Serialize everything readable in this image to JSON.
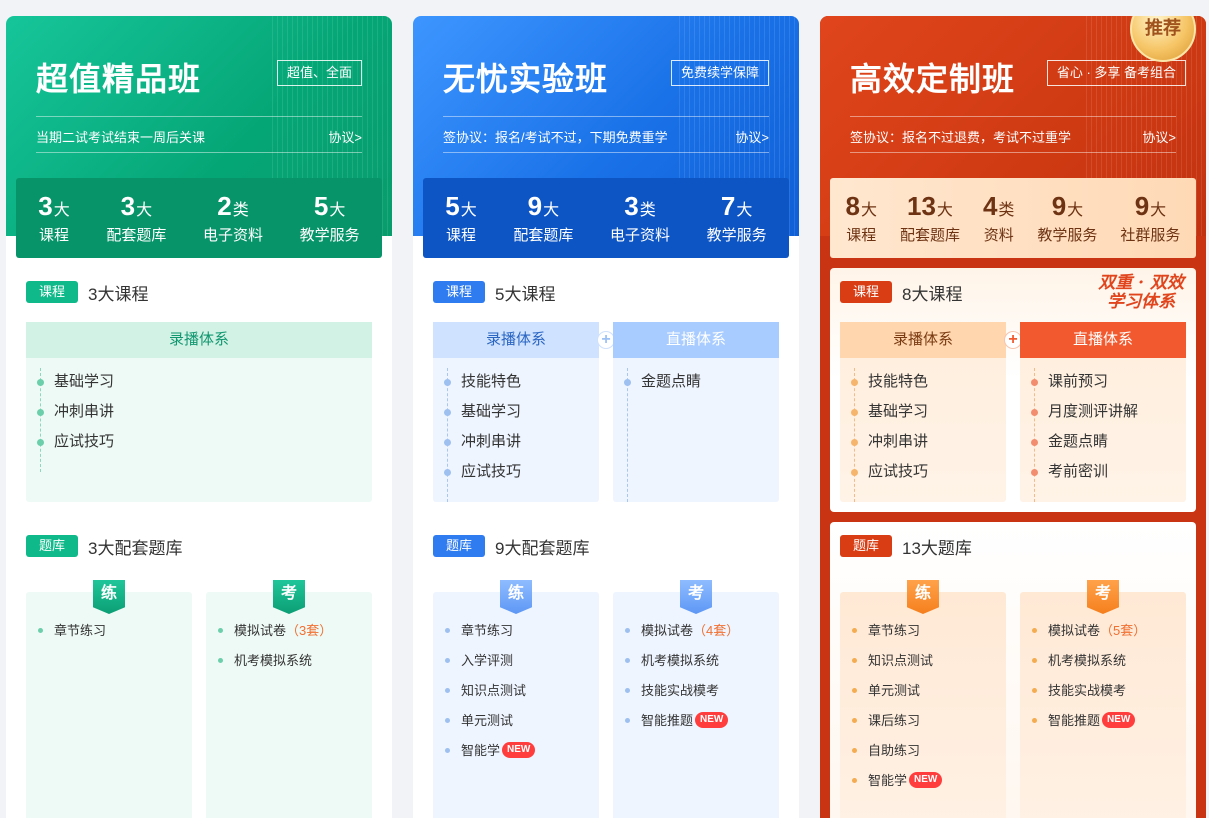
{
  "cards": [
    {
      "title": "超值精品班",
      "tag": "超值、全面",
      "agreement": "当期二试考试结束一周后关课",
      "agreement_link": "协议>",
      "stats": [
        {
          "num": "3",
          "unit": "大",
          "label": "课程"
        },
        {
          "num": "3",
          "unit": "大",
          "label": "配套题库"
        },
        {
          "num": "2",
          "unit": "类",
          "label": "电子资料"
        },
        {
          "num": "5",
          "unit": "大",
          "label": "教学服务"
        }
      ],
      "course": {
        "badge": "课程",
        "title": "3大课程",
        "systems": [
          {
            "name": "录播体系",
            "items": [
              "基础学习",
              "冲刺串讲",
              "应试技巧"
            ]
          }
        ]
      },
      "bank": {
        "badge": "题库",
        "title": "3大配套题库",
        "practice": {
          "label": "练",
          "items": [
            {
              "text": "章节练习"
            }
          ]
        },
        "exam": {
          "label": "考",
          "items": [
            {
              "text": "模拟试卷",
              "extra": "（3套）"
            },
            {
              "text": "机考模拟系统"
            }
          ]
        }
      }
    },
    {
      "title": "无忧实验班",
      "tag": "免费续学保障",
      "agreement": "签协议：报名/考试不过，下期免费重学",
      "agreement_link": "协议>",
      "stats": [
        {
          "num": "5",
          "unit": "大",
          "label": "课程"
        },
        {
          "num": "9",
          "unit": "大",
          "label": "配套题库"
        },
        {
          "num": "3",
          "unit": "类",
          "label": "电子资料"
        },
        {
          "num": "7",
          "unit": "大",
          "label": "教学服务"
        }
      ],
      "course": {
        "badge": "课程",
        "title": "5大课程",
        "systems": [
          {
            "name": "录播体系",
            "items": [
              "技能特色",
              "基础学习",
              "冲刺串讲",
              "应试技巧"
            ]
          },
          {
            "name": "直播体系",
            "items": [
              "金题点睛"
            ]
          }
        ]
      },
      "bank": {
        "badge": "题库",
        "title": "9大配套题库",
        "practice": {
          "label": "练",
          "items": [
            {
              "text": "章节练习"
            },
            {
              "text": "入学评测"
            },
            {
              "text": "知识点测试"
            },
            {
              "text": "单元测试"
            },
            {
              "text": "智能学",
              "new": "NEW"
            }
          ]
        },
        "exam": {
          "label": "考",
          "items": [
            {
              "text": "模拟试卷",
              "extra": "（4套）"
            },
            {
              "text": "机考模拟系统"
            },
            {
              "text": "技能实战模考"
            },
            {
              "text": "智能推题",
              "new": "NEW"
            }
          ]
        }
      }
    },
    {
      "title": "高效定制班",
      "tag": "省心 · 多享 备考组合",
      "agreement": "签协议：报名不过退费，考试不过重学",
      "agreement_link": "协议>",
      "medal": "推荐",
      "slogan_line1": "双重 · 双效",
      "slogan_line2": "学习体系",
      "stats": [
        {
          "num": "8",
          "unit": "大",
          "label": "课程"
        },
        {
          "num": "13",
          "unit": "大",
          "label": "配套题库"
        },
        {
          "num": "4",
          "unit": "类",
          "label": "资料"
        },
        {
          "num": "9",
          "unit": "大",
          "label": "教学服务"
        },
        {
          "num": "9",
          "unit": "大",
          "label": "社群服务"
        }
      ],
      "course": {
        "badge": "课程",
        "title": "8大课程",
        "systems": [
          {
            "name": "录播体系",
            "items": [
              "技能特色",
              "基础学习",
              "冲刺串讲",
              "应试技巧"
            ]
          },
          {
            "name": "直播体系",
            "items": [
              "课前预习",
              "月度测评讲解",
              "金题点睛",
              "考前密训"
            ]
          }
        ]
      },
      "bank": {
        "badge": "题库",
        "title": "13大题库",
        "practice": {
          "label": "练",
          "items": [
            {
              "text": "章节练习"
            },
            {
              "text": "知识点测试"
            },
            {
              "text": "单元测试"
            },
            {
              "text": "课后练习"
            },
            {
              "text": "自助练习"
            },
            {
              "text": "智能学",
              "new": "NEW"
            }
          ]
        },
        "exam": {
          "label": "考",
          "items": [
            {
              "text": "模拟试卷",
              "extra": "（5套）"
            },
            {
              "text": "机考模拟系统"
            },
            {
              "text": "技能实战模考"
            },
            {
              "text": "智能推题",
              "new": "NEW"
            }
          ]
        }
      }
    }
  ],
  "colors": {
    "green": "#079468",
    "blue": "#1a72e8",
    "orange": "#cf3a12"
  }
}
